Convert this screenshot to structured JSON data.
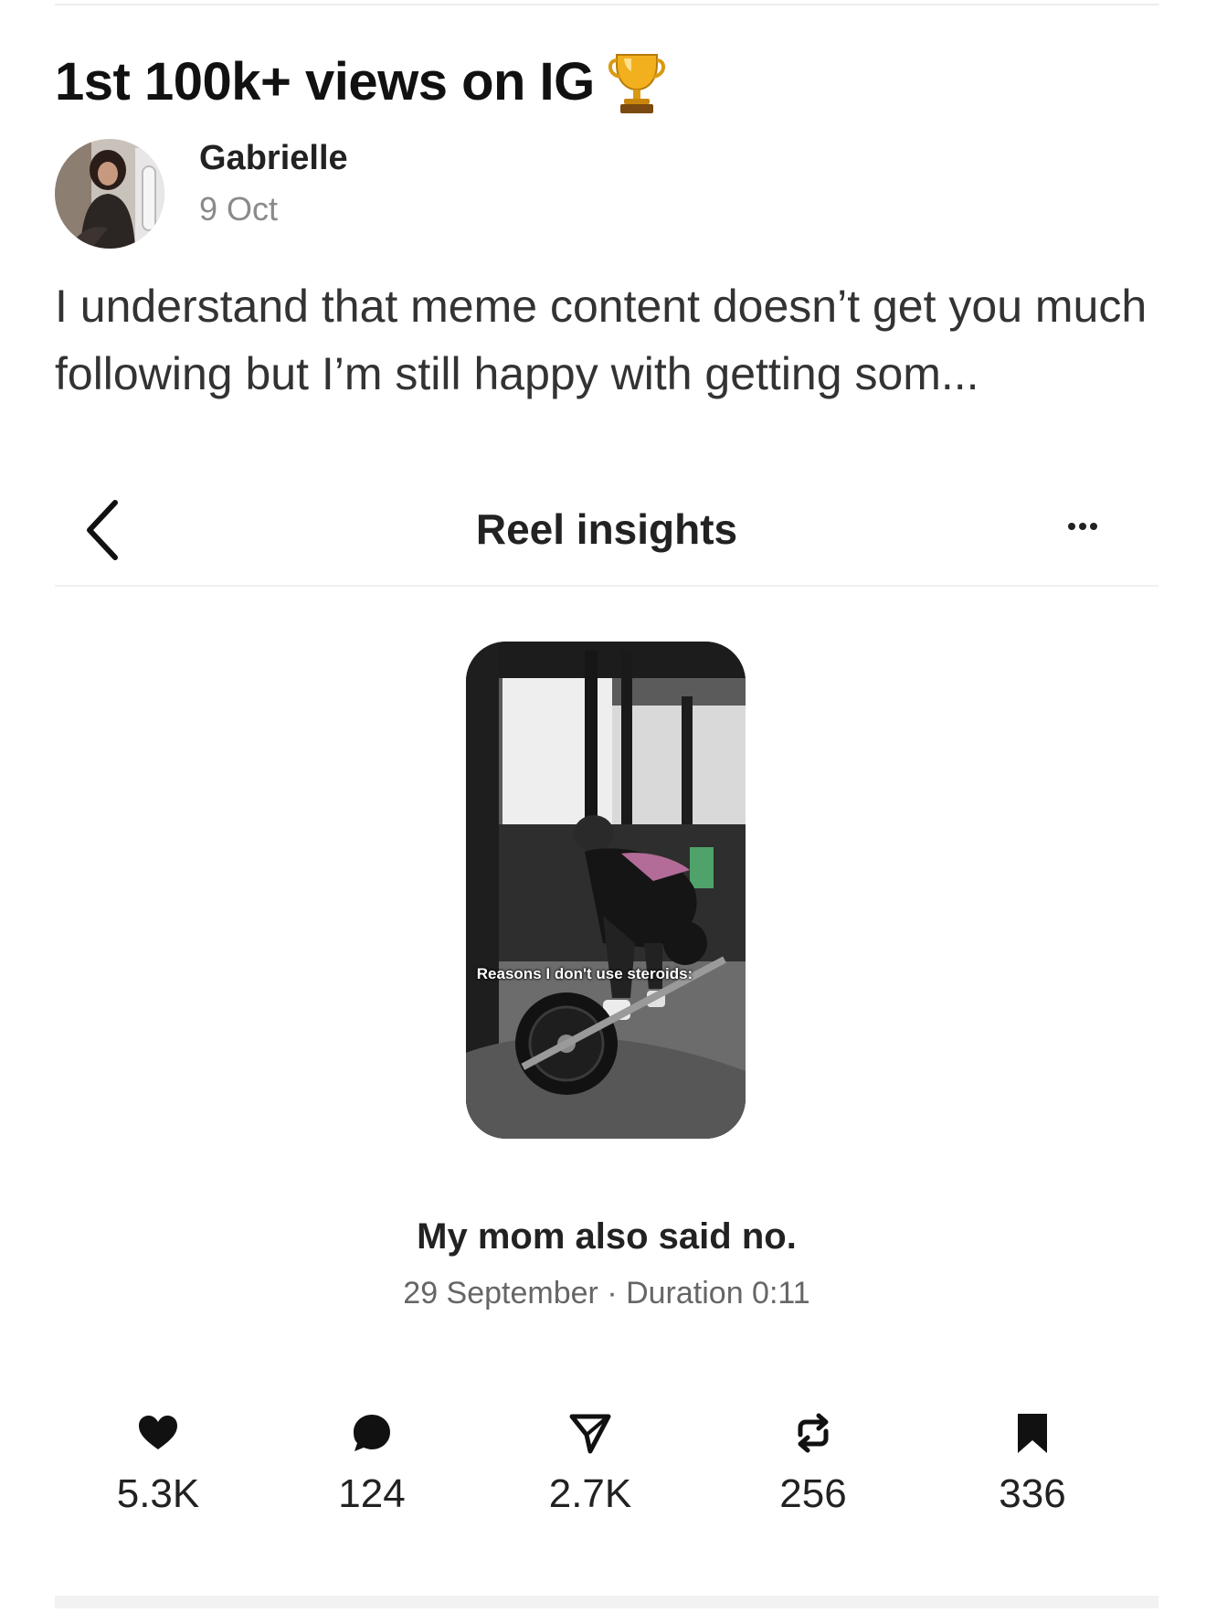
{
  "post": {
    "title": "1st 100k+ views on IG",
    "trophy_icon": "trophy-icon",
    "author": "Gabrielle",
    "date": "9 Oct",
    "excerpt": "I understand that meme content doesn’t get you much following but I’m still happy with getting som..."
  },
  "screenshot": {
    "header": {
      "title": "Reel insights",
      "back_icon": "chevron-left-icon",
      "more_icon": "more-horizontal-icon"
    },
    "thumbnail": {
      "overlay_text": "Reasons I don't use steroids:"
    },
    "caption": "My mom also said no.",
    "meta": "29 September · Duration 0:11",
    "stats": [
      {
        "icon": "heart-icon",
        "value": "5.3K"
      },
      {
        "icon": "comment-icon",
        "value": "124"
      },
      {
        "icon": "send-icon",
        "value": "2.7K"
      },
      {
        "icon": "repost-icon",
        "value": "256"
      },
      {
        "icon": "bookmark-icon",
        "value": "336"
      }
    ]
  }
}
